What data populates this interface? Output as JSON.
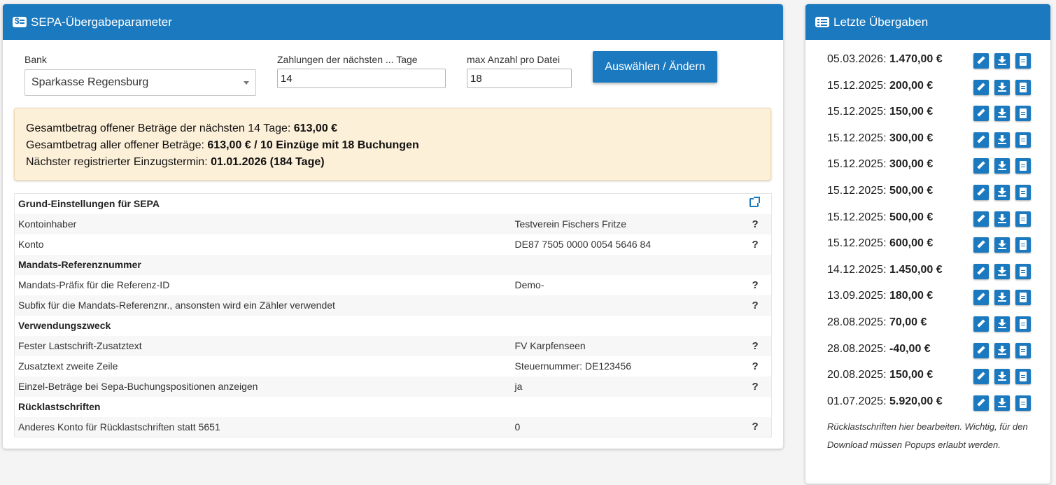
{
  "left_panel": {
    "title": "SEPA-Übergabeparameter",
    "bank_label": "Bank",
    "bank_value": "Sparkasse Regensburg",
    "days_label": "Zahlungen der nächsten ... Tage",
    "days_value": "14",
    "max_label": "max Anzahl pro Datei",
    "max_value": "18",
    "submit_label": "Auswählen / Ändern"
  },
  "summary": {
    "line1_text": "Gesamtbetrag offener Beträge der nächsten 14 Tage: ",
    "line1_value": "613,00 €",
    "line2_text": "Gesamtbetrag aller offener Beträge: ",
    "line2_value": "613,00 € / 10 Einzüge mit 18 Buchungen",
    "line3_text": "Nächster registrierter Einzugstermin: ",
    "line3_value": "01.01.2026 (184 Tage)"
  },
  "settings": {
    "section_basic": "Grund-Einstellungen für SEPA",
    "kontoinhaber_label": "Kontoinhaber",
    "kontoinhaber_value": "Testverein Fischers Fritze",
    "konto_label": "Konto",
    "konto_value": "DE87 7505 0000 0054 5646 84",
    "section_mandate": "Mandats-Referenznummer",
    "prefix_label": "Mandats-Präfix für die Referenz-ID",
    "prefix_value": "Demo-",
    "suffix_label": "Subfix für die Mandats-Referenznr., ansonsten wird ein Zähler verwendet",
    "suffix_value": "",
    "section_purpose": "Verwendungszweck",
    "fixed_text_label": "Fester Lastschrift-Zusatztext",
    "fixed_text_value": "FV Karpfenseen",
    "second_line_label": "Zusatztext zweite Zeile",
    "second_line_value": "Steuernummer: DE123456",
    "single_amounts_label": "Einzel-Beträge bei Sepa-Buchungspositionen anzeigen",
    "single_amounts_value": "ja",
    "section_returns": "Rücklastschriften",
    "other_account_label": "Anderes Konto für Rücklastschriften statt 5651",
    "other_account_value": "0",
    "help_mark": "?"
  },
  "right_panel": {
    "title": "Letzte Übergaben",
    "transfers": [
      {
        "date": "05.03.2026:",
        "amount": "1.470,00 €"
      },
      {
        "date": "15.12.2025:",
        "amount": "200,00 €"
      },
      {
        "date": "15.12.2025:",
        "amount": "150,00 €"
      },
      {
        "date": "15.12.2025:",
        "amount": "300,00 €"
      },
      {
        "date": "15.12.2025:",
        "amount": "300,00 €"
      },
      {
        "date": "15.12.2025:",
        "amount": "500,00 €"
      },
      {
        "date": "15.12.2025:",
        "amount": "500,00 €"
      },
      {
        "date": "15.12.2025:",
        "amount": "600,00 €"
      },
      {
        "date": "14.12.2025:",
        "amount": "1.450,00 €"
      },
      {
        "date": "13.09.2025:",
        "amount": "180,00 €"
      },
      {
        "date": "28.08.2025:",
        "amount": "70,00 €"
      },
      {
        "date": "28.08.2025:",
        "amount": "-40,00 €"
      },
      {
        "date": "20.08.2025:",
        "amount": "150,00 €"
      },
      {
        "date": "01.07.2025:",
        "amount": "5.920,00 €"
      }
    ],
    "note": "Rücklastschriften hier bearbeiten. Wichtig, für den Download müssen Popups erlaubt werden."
  },
  "colors": {
    "accent": "#1b79bf",
    "info_bg": "#fdf0d9"
  }
}
